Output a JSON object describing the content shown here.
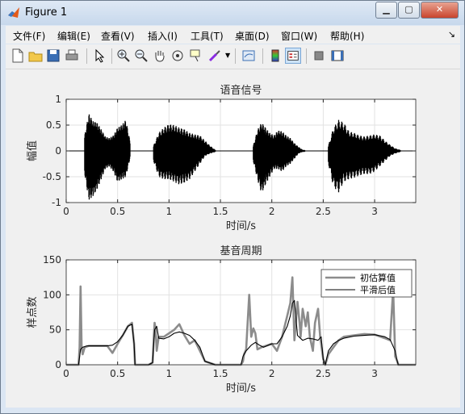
{
  "window": {
    "title": "Figure 1",
    "buttons": [
      "minimize",
      "maximize",
      "close"
    ]
  },
  "menu": {
    "items": [
      "文件(F)",
      "编辑(E)",
      "查看(V)",
      "插入(I)",
      "工具(T)",
      "桌面(D)",
      "窗口(W)",
      "帮助(H)"
    ],
    "dock_arrow": "↘"
  },
  "toolbar": {
    "icons": [
      "new-figure-icon",
      "open-file-icon",
      "save-icon",
      "print-icon",
      "pointer-icon",
      "zoom-in-icon",
      "zoom-out-icon",
      "pan-icon",
      "rotate-icon",
      "data-cursor-icon",
      "brush-icon",
      "link-plot-icon",
      "colorbar-icon",
      "legend-icon",
      "hide-plot-tools-icon",
      "show-plot-tools-icon"
    ]
  },
  "colors": {
    "signal": "#000000",
    "raw_pitch": "#8c8c8c",
    "smooth_pitch": "#000000",
    "axes_bg": "#ffffff",
    "figure_bg": "#f0f0f0"
  },
  "chart_data": [
    {
      "type": "line",
      "title": "语音信号",
      "xlabel": "时间/s",
      "ylabel": "幅值",
      "xlim": [
        0,
        3.4
      ],
      "ylim": [
        -1,
        1
      ],
      "xticks": [
        "0",
        "0.5",
        "1",
        "1.5",
        "2",
        "2.5",
        "3"
      ],
      "xtick_values": [
        0,
        0.5,
        1,
        1.5,
        2,
        2.5,
        3
      ],
      "yticks": [
        "-1",
        "-0.5",
        "0",
        "0.5",
        "1"
      ],
      "ytick_values": [
        -1,
        -0.5,
        0,
        0.5,
        1
      ],
      "grid": true,
      "series": [
        {
          "envelope_segments": [
            {
              "start": 0.18,
              "end": 0.62,
              "x": [
                0.18,
                0.22,
                0.26,
                0.3,
                0.34,
                0.38,
                0.42,
                0.46,
                0.5,
                0.54,
                0.58,
                0.62
              ],
              "pos": [
                0.3,
                0.72,
                0.58,
                0.55,
                0.42,
                0.28,
                0.25,
                0.3,
                0.45,
                0.5,
                0.6,
                0.2
              ],
              "neg": [
                -0.45,
                -0.95,
                -0.88,
                -0.75,
                -0.55,
                -0.35,
                -0.3,
                -0.4,
                -0.6,
                -0.55,
                -0.5,
                -0.15
              ]
            },
            {
              "start": 0.85,
              "end": 1.45,
              "x": [
                0.85,
                0.9,
                0.95,
                1.0,
                1.05,
                1.1,
                1.15,
                1.2,
                1.25,
                1.3,
                1.35,
                1.4,
                1.45
              ],
              "pos": [
                0.1,
                0.35,
                0.45,
                0.52,
                0.5,
                0.45,
                0.42,
                0.35,
                0.32,
                0.3,
                0.2,
                0.1,
                0.02
              ],
              "neg": [
                -0.2,
                -0.5,
                -0.55,
                -0.55,
                -0.6,
                -0.65,
                -0.62,
                -0.55,
                -0.4,
                -0.25,
                -0.1,
                -0.05,
                -0.02
              ]
            },
            {
              "start": 1.82,
              "end": 2.32,
              "x": [
                1.82,
                1.86,
                1.9,
                1.94,
                1.98,
                2.02,
                2.06,
                2.1,
                2.14,
                2.18,
                2.22,
                2.26,
                2.3
              ],
              "pos": [
                0.1,
                0.4,
                0.55,
                0.45,
                0.35,
                0.3,
                0.4,
                0.38,
                0.3,
                0.25,
                0.15,
                0.08,
                0.02
              ],
              "neg": [
                -0.2,
                -0.55,
                -0.82,
                -0.65,
                -0.5,
                -0.35,
                -0.35,
                -0.4,
                -0.3,
                -0.25,
                -0.15,
                -0.05,
                -0.02
              ]
            },
            {
              "start": 2.55,
              "end": 3.25,
              "x": [
                2.55,
                2.6,
                2.65,
                2.7,
                2.75,
                2.8,
                2.85,
                2.9,
                2.95,
                3.0,
                3.05,
                3.1,
                3.15,
                3.2,
                3.25
              ],
              "pos": [
                0.1,
                0.45,
                0.6,
                0.55,
                0.38,
                0.35,
                0.3,
                0.28,
                0.3,
                0.32,
                0.3,
                0.2,
                0.12,
                0.05,
                0.02
              ],
              "neg": [
                -0.25,
                -0.7,
                -0.8,
                -0.6,
                -0.55,
                -0.52,
                -0.48,
                -0.45,
                -0.45,
                -0.4,
                -0.3,
                -0.2,
                -0.1,
                -0.05,
                -0.02
              ]
            }
          ]
        }
      ]
    },
    {
      "type": "line",
      "title": "基音周期",
      "xlabel": "时间/s",
      "ylabel": "样点数",
      "xlim": [
        0,
        3.4
      ],
      "ylim": [
        0,
        150
      ],
      "xticks": [
        "0",
        "0.5",
        "1",
        "1.5",
        "2",
        "2.5",
        "3"
      ],
      "xtick_values": [
        0,
        0.5,
        1,
        1.5,
        2,
        2.5,
        3
      ],
      "yticks": [
        "0",
        "50",
        "100",
        "150"
      ],
      "ytick_values": [
        0,
        50,
        100,
        150
      ],
      "grid": true,
      "legend": {
        "position": "top-right"
      },
      "series": [
        {
          "name": "初估算值",
          "x": [
            0,
            0.12,
            0.13,
            0.14,
            0.15,
            0.16,
            0.18,
            0.22,
            0.3,
            0.4,
            0.45,
            0.5,
            0.55,
            0.6,
            0.64,
            0.66,
            0.67,
            0.8,
            0.84,
            0.85,
            0.86,
            0.87,
            0.88,
            0.9,
            0.95,
            1.0,
            1.05,
            1.1,
            1.15,
            1.2,
            1.25,
            1.3,
            1.35,
            1.45,
            1.5,
            1.55,
            1.7,
            1.72,
            1.73,
            1.75,
            1.78,
            1.8,
            1.82,
            1.84,
            1.86,
            1.9,
            2.0,
            2.05,
            2.1,
            2.15,
            2.18,
            2.2,
            2.22,
            2.25,
            2.27,
            2.28,
            2.3,
            2.33,
            2.35,
            2.37,
            2.4,
            2.42,
            2.45,
            2.47,
            2.5,
            2.52,
            2.55,
            2.6,
            2.65,
            2.7,
            2.8,
            2.9,
            3.0,
            3.1,
            3.15,
            3.18,
            3.2,
            3.22,
            3.23,
            3.25,
            3.4
          ],
          "values": [
            0,
            0,
            25,
            112,
            25,
            15,
            25,
            27,
            27,
            27,
            17,
            30,
            42,
            55,
            60,
            30,
            0,
            0,
            3,
            35,
            60,
            50,
            20,
            40,
            40,
            45,
            50,
            58,
            42,
            30,
            35,
            20,
            5,
            0,
            0,
            0,
            0,
            5,
            15,
            22,
            100,
            40,
            52,
            45,
            22,
            25,
            30,
            20,
            40,
            70,
            88,
            125,
            35,
            90,
            60,
            40,
            80,
            55,
            75,
            40,
            20,
            60,
            80,
            40,
            8,
            0,
            15,
            25,
            35,
            40,
            42,
            44,
            43,
            38,
            35,
            108,
            12,
            5,
            0,
            0,
            0
          ]
        },
        {
          "name": "平滑后值",
          "x": [
            0,
            0.12,
            0.14,
            0.16,
            0.2,
            0.3,
            0.4,
            0.45,
            0.5,
            0.55,
            0.6,
            0.64,
            0.66,
            0.67,
            0.8,
            0.84,
            0.86,
            0.88,
            0.9,
            0.95,
            1.0,
            1.05,
            1.1,
            1.15,
            1.2,
            1.25,
            1.3,
            1.35,
            1.45,
            1.7,
            1.72,
            1.75,
            1.8,
            1.84,
            1.88,
            1.92,
            2.0,
            2.05,
            2.1,
            2.15,
            2.18,
            2.2,
            2.22,
            2.25,
            2.3,
            2.35,
            2.4,
            2.45,
            2.48,
            2.5,
            2.52,
            2.55,
            2.6,
            2.65,
            2.7,
            2.8,
            2.9,
            3.0,
            3.1,
            3.15,
            3.2,
            3.22,
            3.23,
            3.4
          ],
          "values": [
            0,
            0,
            22,
            25,
            27,
            27,
            27,
            28,
            33,
            42,
            55,
            58,
            30,
            0,
            0,
            3,
            50,
            55,
            38,
            37,
            40,
            45,
            47,
            45,
            42,
            35,
            25,
            5,
            0,
            0,
            12,
            20,
            28,
            32,
            28,
            25,
            30,
            30,
            40,
            55,
            70,
            88,
            92,
            42,
            35,
            38,
            37,
            35,
            40,
            8,
            0,
            20,
            30,
            35,
            38,
            41,
            42,
            43,
            40,
            36,
            20,
            5,
            0,
            0
          ]
        }
      ]
    }
  ]
}
